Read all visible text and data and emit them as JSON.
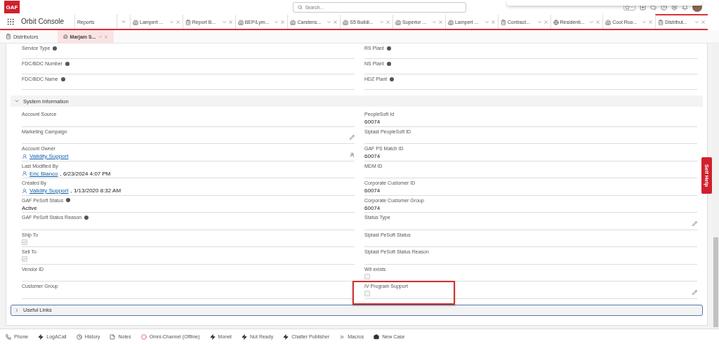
{
  "header": {
    "logo": "GAF",
    "search": {
      "placeholder": "Search..."
    }
  },
  "app_name": "Orbit Console",
  "nav_tabs": [
    {
      "label": "Reports",
      "kind": "menu",
      "selected": false
    },
    {
      "label": "Lampert ...",
      "kind": "account",
      "selected": false
    },
    {
      "label": "Report B...",
      "kind": "report",
      "selected": false
    },
    {
      "label": "BEP/Lym...",
      "kind": "account",
      "selected": false
    },
    {
      "label": "Carstens...",
      "kind": "account",
      "selected": false
    },
    {
      "label": "S5 Buildi...",
      "kind": "account",
      "selected": false
    },
    {
      "label": "Superior ...",
      "kind": "account",
      "selected": false
    },
    {
      "label": "Lampert ...",
      "kind": "account",
      "selected": false
    },
    {
      "label": "Contract...",
      "kind": "report",
      "selected": false
    },
    {
      "label": "Residenti...",
      "kind": "page",
      "selected": false
    },
    {
      "label": "Cool Roo...",
      "kind": "account",
      "selected": false
    },
    {
      "label": "Distribut...",
      "kind": "report",
      "selected": true
    }
  ],
  "sub_tabs": [
    {
      "label": "Distributors",
      "kind": "report",
      "selected": false
    },
    {
      "label": "Marjam S...",
      "kind": "account",
      "selected": true
    }
  ],
  "top_fields": [
    {
      "left": {
        "label": "Service Type",
        "info": true
      },
      "right": {
        "label": "RS Plant",
        "info": true
      }
    },
    {
      "left": {
        "label": "FDC/BDC Number",
        "info": true
      },
      "right": {
        "label": "NS Plant",
        "info": true
      }
    },
    {
      "left": {
        "label": "FDC/BDC Name",
        "info": true
      },
      "right": {
        "label": "HDZ Plant",
        "info": true
      }
    }
  ],
  "sections": [
    {
      "title": "System Information",
      "expanded": true,
      "focused": false,
      "rows": [
        {
          "left": {
            "label": "Account Source"
          },
          "right": {
            "label": "PeopleSoft Id",
            "value": "60074"
          }
        },
        {
          "left": {
            "label": "Marketing Campaign",
            "editable": true
          },
          "right": {
            "label": "Siplast PeopleSoft ID"
          }
        },
        {
          "left": {
            "kind": "link",
            "label": "Account Owner",
            "value": "Validity Support",
            "owner_change": true
          },
          "right": {
            "label": "GAF PS Match ID",
            "value": "60074"
          }
        },
        {
          "left": {
            "kind": "link",
            "label": "Last Modified By",
            "value": "Eric Blanco",
            "suffix": ", 6/23/2024 4:07 PM"
          },
          "right": {
            "label": "MDM ID"
          }
        },
        {
          "left": {
            "kind": "link",
            "label": "Created By",
            "value": "Validity Support",
            "suffix": ", 1/13/2020 8:32 AM"
          },
          "right": {
            "label": "Corporate Customer ID",
            "value": "60074"
          }
        },
        {
          "left": {
            "label": "GAF PeSoft Status",
            "info": true,
            "value": "Active"
          },
          "right": {
            "label": "Corporate Customer Group",
            "value": "60074"
          }
        },
        {
          "left": {
            "label": "GAF PeSoft Status Reason",
            "info": true
          },
          "right": {
            "label": "Status Type",
            "editable": true
          }
        },
        {
          "left": {
            "kind": "checkbox",
            "label": "Ship To",
            "checked": true
          },
          "right": {
            "label": "Siplast PeSoft Status"
          }
        },
        {
          "left": {
            "kind": "checkbox",
            "label": "Sell To",
            "checked": true
          },
          "right": {
            "label": "Siplast PeSoft Status Reason"
          }
        },
        {
          "left": {
            "label": "Vendor ID"
          },
          "right": {
            "kind": "checkbox",
            "label": "W9 exists",
            "checked": false
          }
        },
        {
          "left": {
            "label": "Customer Group"
          },
          "right": {
            "kind": "checkbox",
            "label": "IV Program Support",
            "checked": false,
            "editable": true,
            "highlighted": true
          }
        }
      ]
    },
    {
      "title": "Useful Links",
      "expanded": false,
      "focused": true
    }
  ],
  "side_tab": {
    "label": "Self Help"
  },
  "utility_bar": [
    {
      "label": "Phone",
      "kind": "phone"
    },
    {
      "label": "LogACall",
      "kind": "action"
    },
    {
      "label": "History",
      "kind": "history"
    },
    {
      "label": "Notes",
      "kind": "notes"
    },
    {
      "label": "Omni-Channel (Offline)",
      "kind": "presence"
    },
    {
      "label": "Monet",
      "kind": "action"
    },
    {
      "label": "Not Ready",
      "kind": "action"
    },
    {
      "label": "Chatter Publisher",
      "kind": "action"
    },
    {
      "label": "Macros",
      "kind": "macros"
    },
    {
      "label": "New Case",
      "kind": "case"
    }
  ]
}
